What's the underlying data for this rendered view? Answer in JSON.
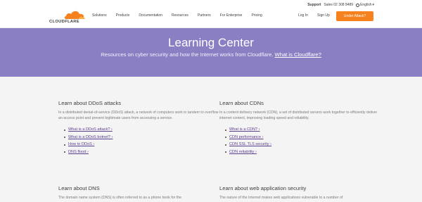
{
  "header": {
    "utility": {
      "support": "Support",
      "sales": "Sales 02 308 8489",
      "language": "English"
    },
    "logo_text": "CLOUDFLARE",
    "nav": [
      "Solutions",
      "Products",
      "Documentation",
      "Resources",
      "Partners",
      "For Enterprise",
      "Pricing"
    ],
    "login": "Log In",
    "signup": "Sign Up",
    "attack_button": "Under Attack?"
  },
  "hero": {
    "title": "Learning Center",
    "subtitle": "Resources on cyber security and how the Internet works from Cloudflare.",
    "link": "What is Cloudflare?"
  },
  "sections": [
    {
      "title": "Learn about DDoS attacks",
      "description": "In a distributed denial-of-service (DDoS) attack, a network of computers work in tandem to overflow an access point and prevent legitimate users from accessing a service.",
      "links": [
        "What is a DDoS attack? ›",
        "What is a DDoS botnet? ›",
        "How to DDoS ›",
        "DNS flood ›"
      ]
    },
    {
      "title": "Learn about CDNs",
      "description": "In a content delivery network (CDN), a set of distributed servers work together to efficiently deliver internet content, improving loading speed and reliability.",
      "links": [
        "What is a CDN? ›",
        "CDN performance ›",
        "CDN SSL TLS security ›",
        "CDN reliability ›"
      ]
    },
    {
      "title": "Learn about DNS",
      "description": "The domain name system (DNS) is often referred to as a phone book for the"
    },
    {
      "title": "Learn about web application security",
      "description": "The nature of the Internet makes web applications vulnerable to a number of"
    }
  ],
  "colors": {
    "accent": "#f6821f",
    "hero": "#8b7fc4",
    "link": "#5a3d8c"
  }
}
